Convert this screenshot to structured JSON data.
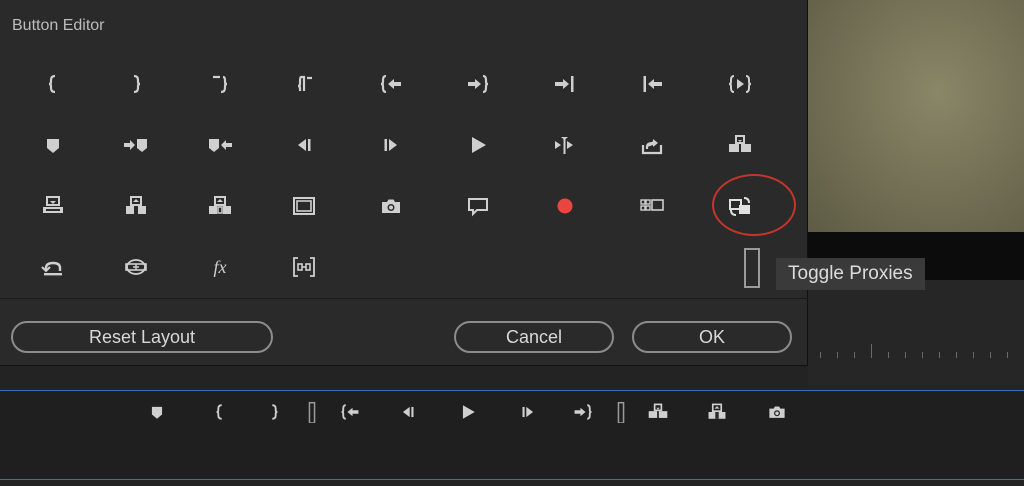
{
  "dialog": {
    "title": "Button Editor",
    "reset_label": "Reset Layout",
    "cancel_label": "Cancel",
    "ok_label": "OK"
  },
  "tooltip": "Toggle Proxies",
  "grid_rows": [
    [
      "mark-in-icon",
      "mark-out-icon",
      "mark-clip-icon",
      "go-to-in-icon",
      "go-to-in-point-icon",
      "go-to-out-point-icon",
      "go-to-next-edit-icon",
      "go-to-previous-edit-icon",
      "play-in-to-out-icon"
    ],
    [
      "add-marker-icon",
      "go-to-next-marker-icon",
      "go-to-previous-marker-icon",
      "step-back-icon",
      "step-forward-icon",
      "play-icon",
      "play-around-icon",
      "export-icon",
      "insert-icon"
    ],
    [
      "lift-icon",
      "overwrite-icon",
      "extract-icon",
      "safe-margins-icon",
      "camera-icon",
      "comment-icon",
      "record-icon",
      "multi-camera-icon",
      "toggle-proxies-icon"
    ],
    [
      "loop-icon",
      "vr-video-icon",
      "fx-icon",
      "trim-icon"
    ]
  ],
  "transport_icons": [
    "add-marker-icon",
    "mark-in-icon",
    "mark-out-icon",
    "spacer-icon",
    "go-to-in-point-icon",
    "step-back-icon",
    "play-icon",
    "step-forward-icon",
    "go-to-out-point-icon",
    "spacer-icon",
    "insert-icon",
    "overwrite-icon",
    "camera-icon"
  ],
  "fx_text": "fx",
  "colors": {
    "accent_blue": "#3a6fb5",
    "record_red": "#e8463f",
    "highlight_red": "#c4352c"
  }
}
